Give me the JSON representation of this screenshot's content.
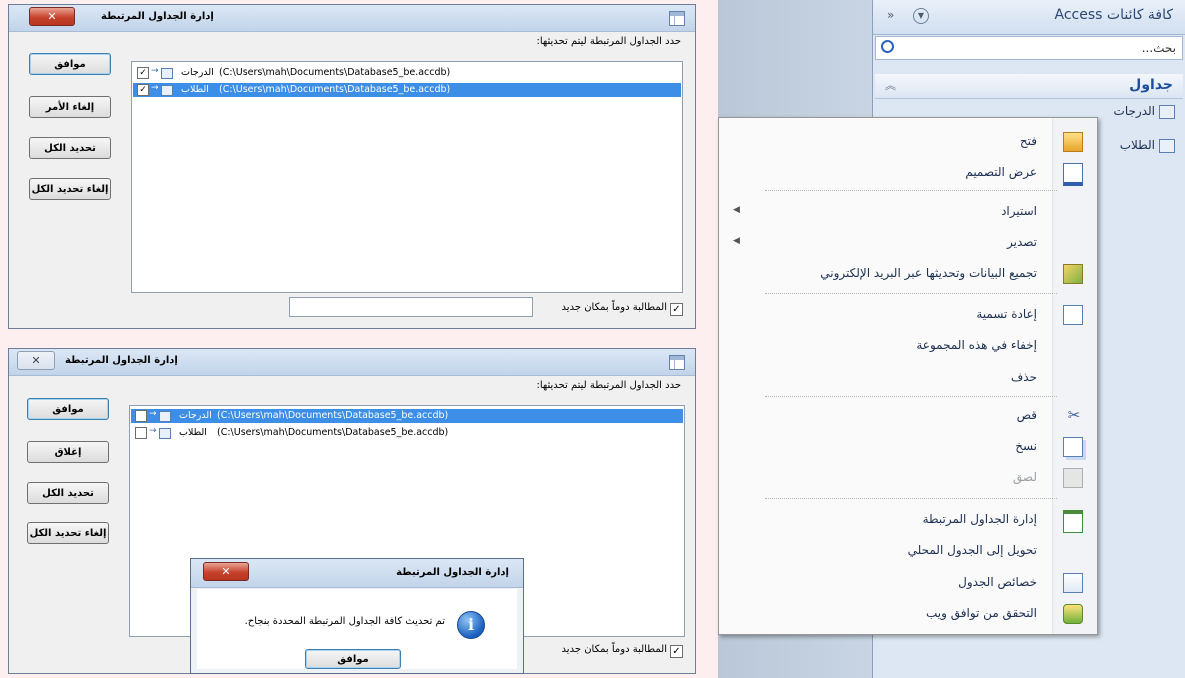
{
  "dialog1": {
    "title": "إدارة الجداول المرتبطة",
    "prompt": "حدد الجداول المرتبطة ليتم تحديثها:",
    "rows": [
      {
        "name": "الدرجات",
        "path": "(C:\\Users\\mah\\Documents\\Database5_be.accdb)",
        "checked": "✓"
      },
      {
        "name": "الطلاب",
        "path": "(C:\\Users\\mah\\Documents\\Database5_be.accdb)",
        "checked": "✓"
      }
    ],
    "buttons": [
      "موافق",
      "إلغاء الأمر",
      "تحديد الكل",
      "إلغاء تحديد الكل"
    ],
    "always_prompt": "المطالبة دوماً بمكان جديد",
    "always_prompt_checked": "✓"
  },
  "dialog2": {
    "title": "إدارة الجداول المرتبطة",
    "prompt": "حدد الجداول المرتبطة ليتم تحديثها:",
    "rows": [
      {
        "name": "الدرجات",
        "path": "(C:\\Users\\mah\\Documents\\Database5_be.accdb)",
        "checked": ""
      },
      {
        "name": "الطلاب",
        "path": "(C:\\Users\\mah\\Documents\\Database5_be.accdb)",
        "checked": ""
      }
    ],
    "buttons": [
      "موافق",
      "إغلاق",
      "تحديد الكل",
      "إلغاء تحديد الكل"
    ],
    "always_prompt": "المطالبة دوماً بمكان جديد",
    "always_prompt_checked": "✓"
  },
  "message_box": {
    "title": "إدارة الجداول المرتبطة",
    "message": "تم تحديث كافة الجداول المرتبطة المحددة بنجاح.",
    "ok": "موافق"
  },
  "nav_pane": {
    "title": "كافة كائنات Access",
    "search_placeholder": "بحث...",
    "group": "جداول",
    "items": [
      "الدرجات",
      "الطلاب"
    ]
  },
  "context_menu": {
    "items": [
      {
        "label": "فتح",
        "icon": "open-icon",
        "submenu": ""
      },
      {
        "label": "عرض التصميم",
        "icon": "design-view-icon",
        "submenu": ""
      },
      {
        "label": "استيراد",
        "icon": "",
        "submenu": "◀"
      },
      {
        "label": "تصدير",
        "icon": "",
        "submenu": "◀"
      },
      {
        "label": "تجميع البيانات وتحديثها عبر البريد الإلكتروني",
        "icon": "collect-data-icon",
        "submenu": ""
      },
      {
        "label": "إعادة تسمية",
        "icon": "rename-icon",
        "submenu": ""
      },
      {
        "label": "إخفاء في هذه المجموعة",
        "icon": "",
        "submenu": ""
      },
      {
        "label": "حذف",
        "icon": "",
        "submenu": ""
      },
      {
        "label": "قص",
        "icon": "cut-icon",
        "submenu": ""
      },
      {
        "label": "نسخ",
        "icon": "copy-icon",
        "submenu": ""
      },
      {
        "label": "لصق",
        "icon": "paste-icon",
        "submenu": "",
        "disabled": true
      },
      {
        "label": "إدارة الجداول المرتبطة",
        "icon": "linked-table-manager-icon",
        "submenu": ""
      },
      {
        "label": "تحويل إلى الجدول المحلي",
        "icon": "",
        "submenu": ""
      },
      {
        "label": "خصائص الجدول",
        "icon": "table-properties-icon",
        "submenu": ""
      },
      {
        "label": "التحقق من توافق ويب",
        "icon": "web-compat-icon",
        "submenu": ""
      }
    ]
  },
  "colors": {
    "background": "#fdeef0",
    "selection": "#3c8ee6",
    "close_button": "#c7422c",
    "nav_group": "#1f4e9a"
  }
}
